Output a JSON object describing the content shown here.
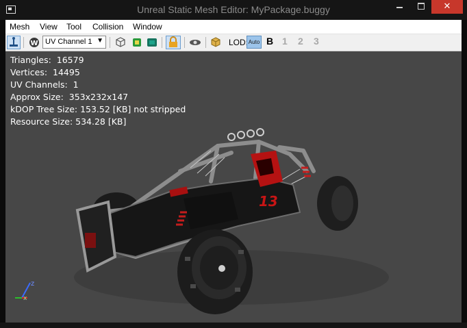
{
  "window": {
    "title": "Unreal Static Mesh Editor: MyPackage.buggy",
    "close_glyph": "✕"
  },
  "menu": [
    "Mesh",
    "View",
    "Tool",
    "Collision",
    "Window"
  ],
  "toolbar": {
    "uv_channel": "UV Channel 1",
    "lod_label": "LOD:",
    "lod_auto": "Auto",
    "lod_levels": [
      "B",
      "1",
      "2",
      "3"
    ],
    "icons": [
      "pivot-icon",
      "uv-view-icon",
      "wireframe-cube-icon",
      "green-square-icon",
      "collision-icon",
      "lock-icon",
      "eye-icon",
      "material-cube-icon"
    ]
  },
  "stats": [
    "Triangles:  16579",
    "Vertices:  14495",
    "UV Channels:  1",
    "Approx Size:  353x232x147",
    "kDOP Tree Size: 153.52 [KB] not stripped",
    "Resource Size: 534.28 [KB]"
  ],
  "model": {
    "number_decal": "13",
    "colors": {
      "body": "#151515",
      "frame": "#8d8d8d",
      "accent": "#c81515",
      "tire": "#222222"
    }
  },
  "axis": {
    "x_label": "x",
    "z_label": "z"
  }
}
